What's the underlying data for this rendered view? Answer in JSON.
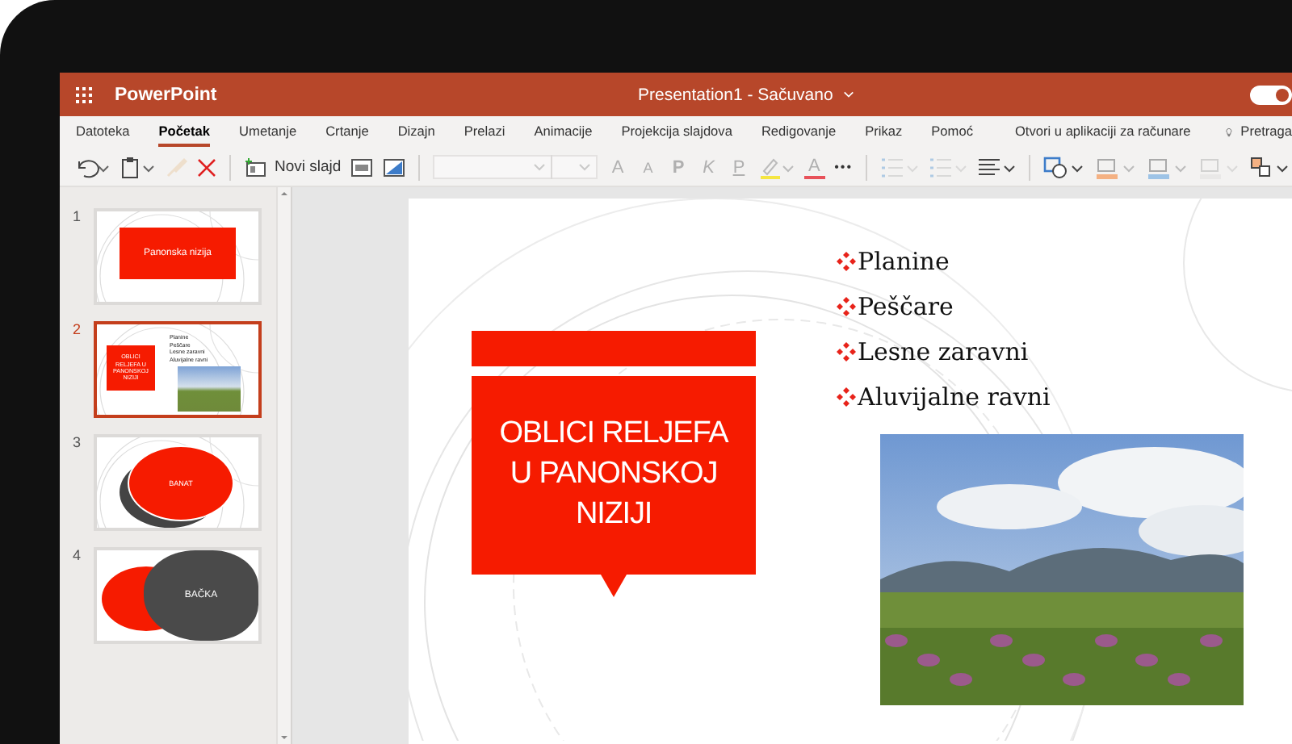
{
  "app": {
    "name": "PowerPoint"
  },
  "document": {
    "title": "Presentation1 - Sačuvano"
  },
  "ribbon_toggle": {
    "on": true
  },
  "tabs": [
    {
      "label": "Datoteka",
      "selected": false
    },
    {
      "label": "Početak",
      "selected": true
    },
    {
      "label": "Umetanje",
      "selected": false
    },
    {
      "label": "Crtanje",
      "selected": false
    },
    {
      "label": "Dizajn",
      "selected": false
    },
    {
      "label": "Prelazi",
      "selected": false
    },
    {
      "label": "Animacije",
      "selected": false
    },
    {
      "label": "Projekcija slajdova",
      "selected": false
    },
    {
      "label": "Redigovanje",
      "selected": false
    },
    {
      "label": "Prikaz",
      "selected": false
    },
    {
      "label": "Pomoć",
      "selected": false
    }
  ],
  "open_in_app": {
    "label": "Otvori u aplikaciji za računare"
  },
  "search": {
    "label": "Pretraga"
  },
  "toolbar": [
    {
      "kind": "undo",
      "disabled": false
    },
    {
      "kind": "paste",
      "disabled": false
    },
    {
      "kind": "format_painter",
      "disabled": true
    },
    {
      "kind": "delete",
      "disabled": false
    },
    {
      "kind": "separator"
    },
    {
      "kind": "new_slide",
      "label": "Novi slajd",
      "disabled": false
    },
    {
      "kind": "layout",
      "disabled": false
    },
    {
      "kind": "background",
      "disabled": false
    },
    {
      "kind": "separator"
    },
    {
      "kind": "font_name",
      "disabled": true
    },
    {
      "kind": "font_size",
      "disabled": true
    },
    {
      "kind": "grow",
      "label": "A",
      "disabled": true
    },
    {
      "kind": "shrink",
      "label": "A",
      "disabled": true
    },
    {
      "kind": "bold",
      "label": "P",
      "disabled": true
    },
    {
      "kind": "italic",
      "label": "K",
      "disabled": true
    },
    {
      "kind": "underline",
      "label": "P",
      "disabled": true
    },
    {
      "kind": "highlight",
      "disabled": false
    },
    {
      "kind": "font_color",
      "label": "A",
      "disabled": true
    },
    {
      "kind": "more",
      "label": "•••",
      "disabled": false
    },
    {
      "kind": "separator"
    },
    {
      "kind": "bullets",
      "disabled": true
    },
    {
      "kind": "numbering",
      "disabled": true
    },
    {
      "kind": "align",
      "disabled": false
    },
    {
      "kind": "separator"
    },
    {
      "kind": "shapes",
      "disabled": false
    },
    {
      "kind": "fill",
      "disabled": false
    },
    {
      "kind": "outline",
      "disabled": false
    },
    {
      "kind": "effects",
      "disabled": true
    },
    {
      "kind": "arrange",
      "disabled": false
    }
  ],
  "slides": [
    {
      "number": "1",
      "selected": false,
      "kind": "title",
      "title": "Panonska nizija"
    },
    {
      "number": "2",
      "selected": true,
      "kind": "title_bullets",
      "title": "OBLICI RELJEFA U PANONSKOJ NIZIJI",
      "bullets": [
        "Planine",
        "Peščare",
        "Lesne zaravni",
        "Aluvijalne ravni"
      ]
    },
    {
      "number": "3",
      "selected": false,
      "kind": "ellipse",
      "title": "BANAT"
    },
    {
      "number": "4",
      "selected": false,
      "kind": "blobs",
      "title": "BAČKA"
    }
  ],
  "current_slide": {
    "title": "OBLICI RELJEFA U PANONSKOJ NIZIJI",
    "bullets": [
      "Planine",
      "Peščare",
      "Lesne zaravni",
      "Aluvijalne ravni"
    ]
  }
}
